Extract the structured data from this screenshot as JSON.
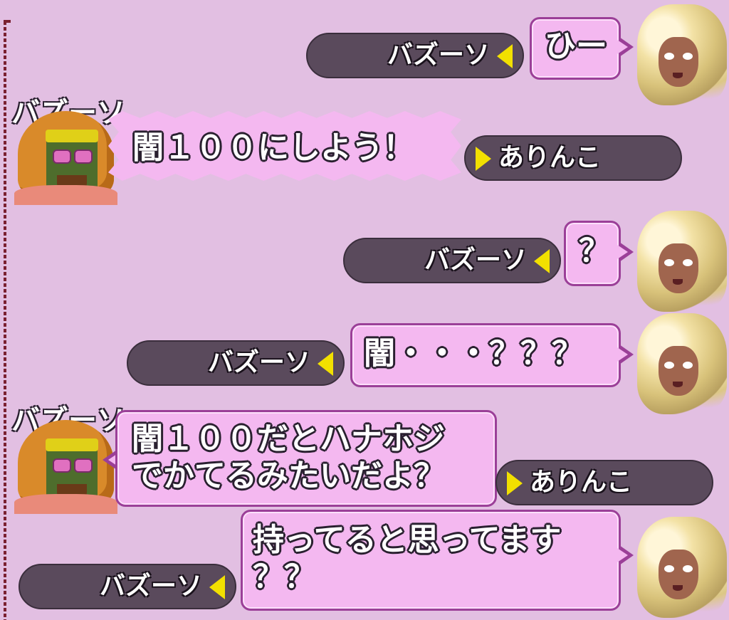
{
  "messages": [
    {
      "speaker": "self",
      "text": "ひー",
      "pill_name": "バズーソ"
    },
    {
      "speaker": "バズーソ",
      "text": "闇１００にしよう！",
      "pill_name": "ありんこ"
    },
    {
      "speaker": "self",
      "text": "？",
      "pill_name": "バズーソ"
    },
    {
      "speaker": "self",
      "text": "闇・・・？？？",
      "pill_name": "バズーソ"
    },
    {
      "speaker": "バズーソ",
      "line1": "闇１００だとハナホジ",
      "line2": "でかてるみたいだよ？",
      "pill_name": "ありんこ"
    },
    {
      "speaker": "self",
      "line1": "持ってると思ってます",
      "line2": "？？",
      "pill_name": "バズーソ"
    }
  ],
  "colors": {
    "background": "#e2bfe2",
    "bubble": "#f4b8f0",
    "pill": "#5a4a5c",
    "arrow": "#f2e000"
  }
}
